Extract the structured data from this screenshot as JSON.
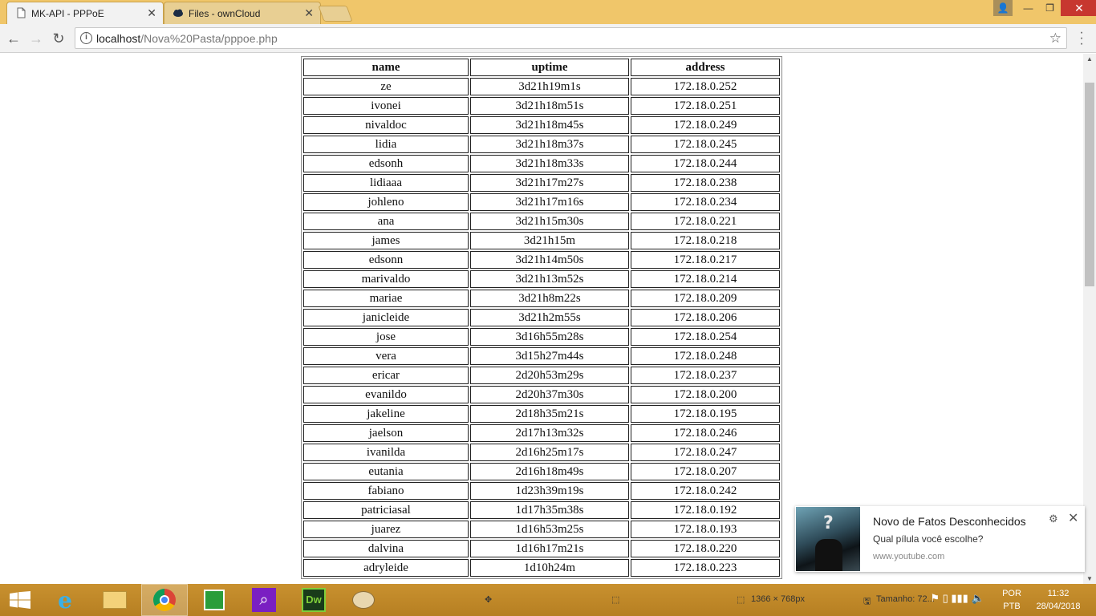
{
  "browser": {
    "tabs": [
      {
        "title": "MK-API - PPPoE",
        "active": true
      },
      {
        "title": "Files - ownCloud",
        "active": false
      }
    ],
    "url_host": "localhost",
    "url_path": "/Nova%20Pasta/pppoe.php"
  },
  "table": {
    "headers": [
      "name",
      "uptime",
      "address"
    ],
    "rows": [
      [
        "ze",
        "3d21h19m1s",
        "172.18.0.252"
      ],
      [
        "ivonei",
        "3d21h18m51s",
        "172.18.0.251"
      ],
      [
        "nivaldoc",
        "3d21h18m45s",
        "172.18.0.249"
      ],
      [
        "lidia",
        "3d21h18m37s",
        "172.18.0.245"
      ],
      [
        "edsonh",
        "3d21h18m33s",
        "172.18.0.244"
      ],
      [
        "lidiaaa",
        "3d21h17m27s",
        "172.18.0.238"
      ],
      [
        "johleno",
        "3d21h17m16s",
        "172.18.0.234"
      ],
      [
        "ana",
        "3d21h15m30s",
        "172.18.0.221"
      ],
      [
        "james",
        "3d21h15m",
        "172.18.0.218"
      ],
      [
        "edsonn",
        "3d21h14m50s",
        "172.18.0.217"
      ],
      [
        "marivaldo",
        "3d21h13m52s",
        "172.18.0.214"
      ],
      [
        "mariae",
        "3d21h8m22s",
        "172.18.0.209"
      ],
      [
        "janicleide",
        "3d21h2m55s",
        "172.18.0.206"
      ],
      [
        "jose",
        "3d16h55m28s",
        "172.18.0.254"
      ],
      [
        "vera",
        "3d15h27m44s",
        "172.18.0.248"
      ],
      [
        "ericar",
        "2d20h53m29s",
        "172.18.0.237"
      ],
      [
        "evanildo",
        "2d20h37m30s",
        "172.18.0.200"
      ],
      [
        "jakeline",
        "2d18h35m21s",
        "172.18.0.195"
      ],
      [
        "jaelson",
        "2d17h13m32s",
        "172.18.0.246"
      ],
      [
        "ivanilda",
        "2d16h25m17s",
        "172.18.0.247"
      ],
      [
        "eutania",
        "2d16h18m49s",
        "172.18.0.207"
      ],
      [
        "fabiano",
        "1d23h39m19s",
        "172.18.0.242"
      ],
      [
        "patriciasal",
        "1d17h35m38s",
        "172.18.0.192"
      ],
      [
        "juarez",
        "1d16h53m25s",
        "172.18.0.193"
      ],
      [
        "dalvina",
        "1d16h17m21s",
        "172.18.0.220"
      ],
      [
        "adryleide",
        "1d10h24m",
        "172.18.0.223"
      ]
    ]
  },
  "notification": {
    "title": "Novo de Fatos Desconhecidos",
    "message": "Qual pílula você escolhe?",
    "source": "www.youtube.com"
  },
  "taskbar": {
    "screen_size": "1366 × 768px",
    "size_label": "Tamanho: 72...",
    "language": "POR",
    "keyboard": "PTB",
    "time": "11:32",
    "date": "28/04/2018"
  }
}
